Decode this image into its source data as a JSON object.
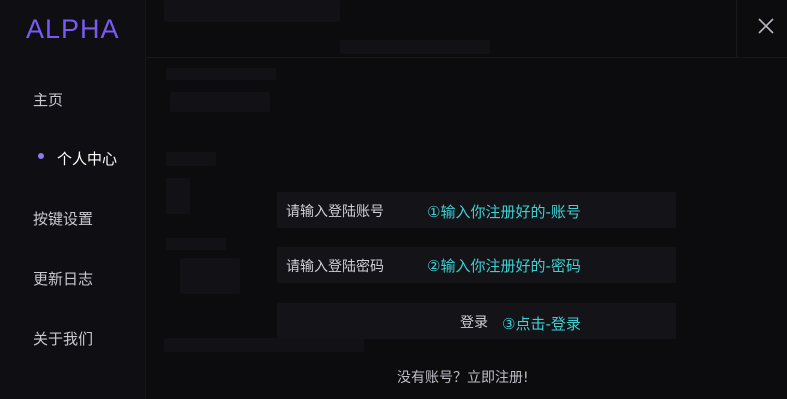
{
  "app": {
    "logo": "ALPHA"
  },
  "sidebar": {
    "items": [
      {
        "label": "主页",
        "active": false
      },
      {
        "label": "个人中心",
        "active": true
      },
      {
        "label": "按键设置",
        "active": false
      },
      {
        "label": "更新日志",
        "active": false
      },
      {
        "label": "关于我们",
        "active": false
      }
    ]
  },
  "login": {
    "account_placeholder": "请输入登陆账号",
    "account_hint": "①输入你注册好的-账号",
    "password_placeholder": "请输入登陆密码",
    "password_hint": "②输入你注册好的-密码",
    "login_label": "登录",
    "login_hint": "③点击-登录",
    "register_link": "没有账号？立即注册!"
  },
  "colors": {
    "accent": "#7a5af5",
    "hint": "#3ed0d2",
    "background": "#0c0c0f"
  },
  "icons": {
    "close": "close-icon",
    "active_dot": "bullet-dot-icon"
  }
}
